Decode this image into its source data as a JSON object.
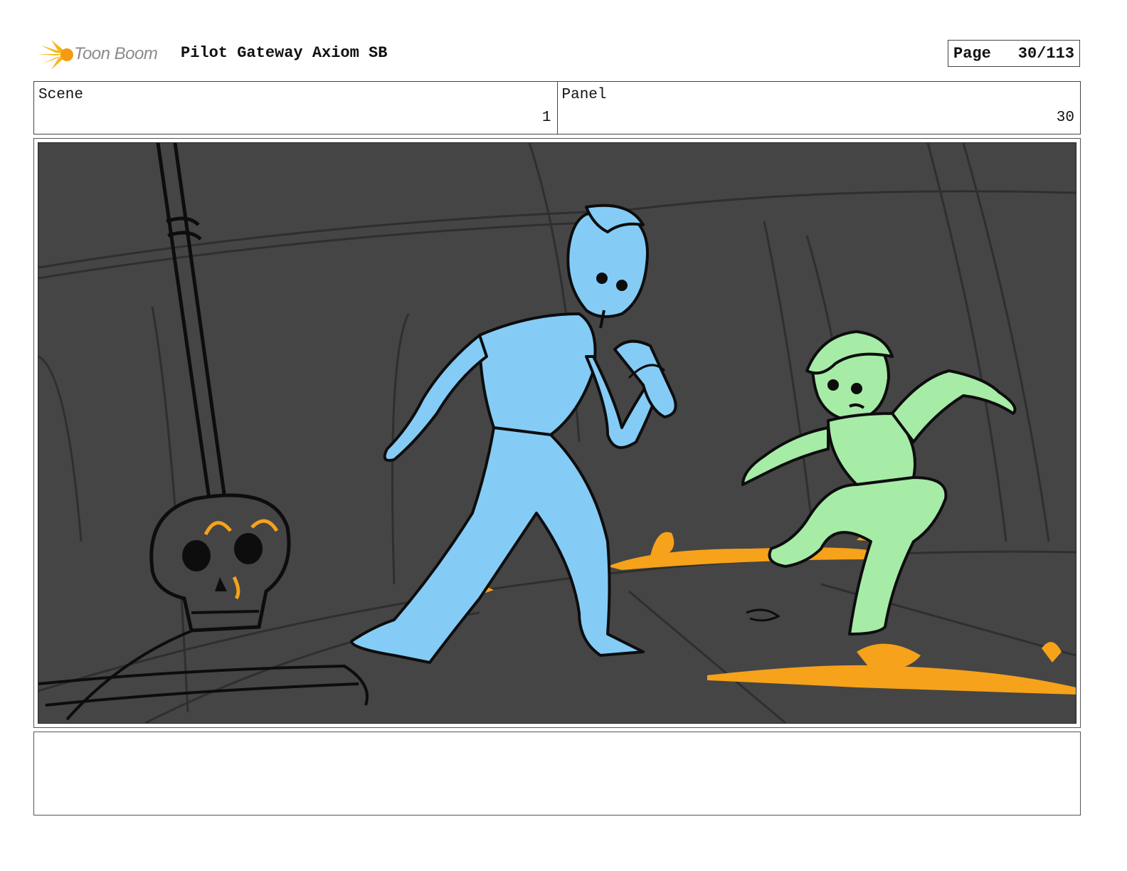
{
  "header": {
    "logo_text": "Toon Boom",
    "project_title": "Pilot Gateway Axiom SB",
    "page_label": "Page",
    "page_value": "30/113"
  },
  "info": {
    "scene_label": "Scene",
    "scene_value": "1",
    "panel_label": "Panel",
    "panel_value": "30"
  },
  "panel_image": {
    "icon": "storyboard-sketch",
    "colors": {
      "background": "#454545",
      "man": "#84ccf6",
      "boy": "#a6eca7",
      "lava": "#f6a21a",
      "line": "#0d0d0d"
    }
  },
  "notes": {
    "text": ""
  }
}
